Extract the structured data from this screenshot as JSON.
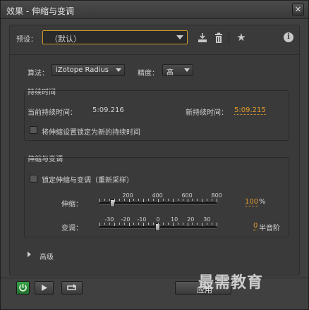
{
  "window": {
    "title": "效果 - 伸缩与变调",
    "close_label": "✕"
  },
  "preset": {
    "label": "预设：",
    "value": "（默认）"
  },
  "algorithm": {
    "label": "算法：",
    "value": "iZotope Radius"
  },
  "precision": {
    "label": "精度：",
    "value": "高"
  },
  "duration": {
    "title": "持续时间",
    "current_label": "当前持续时间：",
    "current_value": "5:09.216",
    "new_label": "新持续时间：",
    "new_value": "5:09.215",
    "lock_label": "将伸缩设置锁定为新的持续时间",
    "lock_checked": false
  },
  "stretch_pitch": {
    "title": "伸缩与变调",
    "lock_label": "锁定伸缩与变调（重新采样）",
    "lock_checked": false,
    "stretch": {
      "label": "伸缩：",
      "scale": [
        "200",
        "400",
        "600",
        "800"
      ],
      "value": "100",
      "unit": "%",
      "level": 100,
      "min": 10,
      "max": 800
    },
    "pitch": {
      "label": "变调：",
      "scale": [
        "-30",
        "-20",
        "-10",
        "0",
        "10",
        "20",
        "30"
      ],
      "value": "0",
      "unit": "半音阶",
      "level": 0,
      "min": -36,
      "max": 36
    }
  },
  "advanced": {
    "label": "高级"
  },
  "footer": {
    "apply_label": "应用"
  },
  "watermark": "最需教育",
  "colors": {
    "accent": "#e09a2b",
    "power_green": "#2e8a3a"
  }
}
